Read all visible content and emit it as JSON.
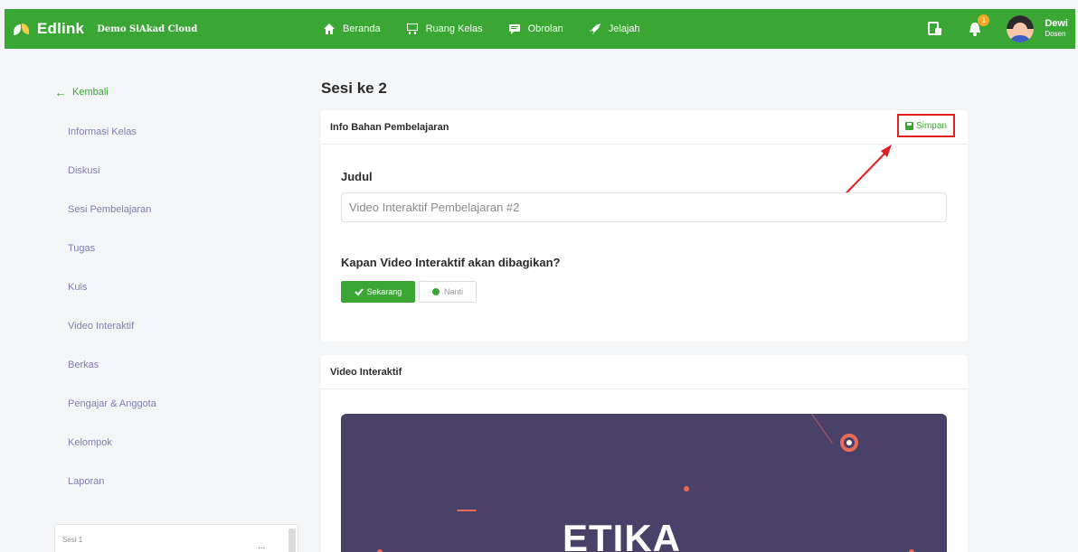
{
  "navbar": {
    "brand": "Edlink",
    "institution": "Demo SiAkad Cloud",
    "links": [
      {
        "label": "Beranda",
        "icon": "home-icon"
      },
      {
        "label": "Ruang Kelas",
        "icon": "classroom-icon"
      },
      {
        "label": "Obrolan",
        "icon": "chat-icon"
      },
      {
        "label": "Jelajah",
        "icon": "rocket-icon"
      }
    ],
    "notification_count": "1",
    "user": {
      "name": "Dewi",
      "role": "Dosen"
    }
  },
  "sidebar": {
    "back_label": "Kembali",
    "items": [
      {
        "label": "Informasi Kelas"
      },
      {
        "label": "Diskusi"
      },
      {
        "label": "Sesi Pembelajaran"
      },
      {
        "label": "Tugas"
      },
      {
        "label": "Kuis"
      },
      {
        "label": "Video Interaktif"
      },
      {
        "label": "Berkas"
      },
      {
        "label": "Pengajar & Anggota"
      },
      {
        "label": "Kelompok"
      },
      {
        "label": "Laporan"
      }
    ],
    "session_box": {
      "label": "Sesi 1",
      "more": "..."
    }
  },
  "main": {
    "title": "Sesi ke 2",
    "info_card": {
      "header": "Info Bahan Pembelajaran",
      "save_label": "Simpan",
      "field_label": "Judul",
      "field_value": "Video Interaktif Pembelajaran #2",
      "question": "Kapan Video Interaktif akan dibagikan?",
      "option_now": "Sekarang",
      "option_later": "Nanti"
    },
    "video_card": {
      "header": "Video Interaktif",
      "preview_title": "ETIKA"
    }
  },
  "colors": {
    "primary": "#3aa634",
    "highlight": "#e02020",
    "sidebar_text": "#7d7fb1",
    "video_bg": "#4a4169",
    "accent": "#e96b55"
  }
}
